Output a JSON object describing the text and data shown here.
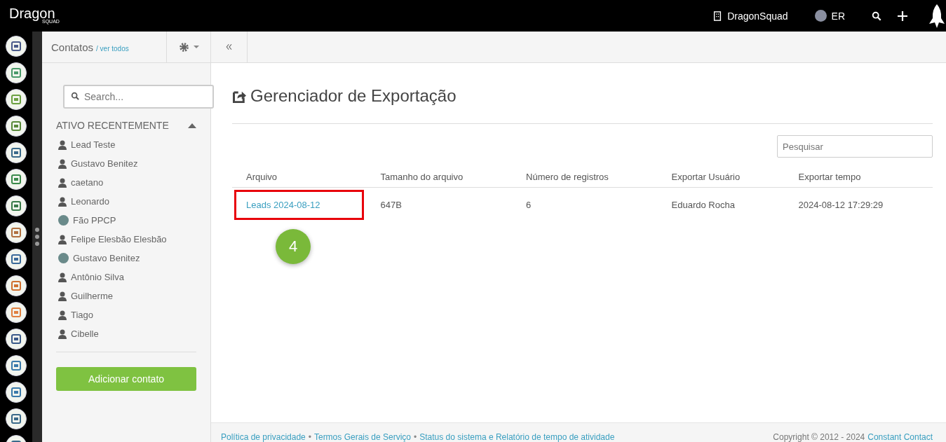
{
  "topbar": {
    "logo": "Dragon",
    "logo_sub": "SQUAD",
    "company": "DragonSquad",
    "user": "ER"
  },
  "sidebar": {
    "title": "Contatos",
    "view_all": "/ ver todos",
    "search": {
      "placeholder": "Search..."
    },
    "section": "ATIVO RECENTEMENTE",
    "section_expanded": true,
    "contacts": [
      {
        "name": "Lead Teste",
        "kind": "person"
      },
      {
        "name": "Gustavo Benitez",
        "kind": "person"
      },
      {
        "name": "caetano",
        "kind": "person"
      },
      {
        "name": "Leonardo",
        "kind": "person"
      },
      {
        "name": "Fão PPCP",
        "kind": "photo"
      },
      {
        "name": "Felipe Elesbão Elesbão",
        "kind": "person"
      },
      {
        "name": "Gustavo Benitez",
        "kind": "photo"
      },
      {
        "name": "Antônio Silva",
        "kind": "person"
      },
      {
        "name": "Guilherme",
        "kind": "person"
      },
      {
        "name": "Tiago",
        "kind": "person"
      },
      {
        "name": "Cibelle",
        "kind": "person"
      }
    ],
    "add_button": "Adicionar contato"
  },
  "main": {
    "title": "Gerenciador de Exportação",
    "search": {
      "placeholder": "Pesquisar"
    },
    "table": {
      "columns": [
        "Arquivo",
        "Tamanho do arquivo",
        "Número de registros",
        "Exportar Usuário",
        "Exportar tempo"
      ],
      "rows": [
        {
          "file": "Leads 2024-08-12",
          "size": "647B",
          "records": "6",
          "user": "Eduardo Rocha",
          "time": "2024-08-12 17:29:29",
          "highlighted": true
        }
      ]
    },
    "step_badge": "4"
  },
  "footer": {
    "links": [
      "Política de privacidade",
      "Termos Gerais de Serviço",
      "Status do sistema e Relatório de tempo de atividade"
    ],
    "separator": "•",
    "copyright": "Copyright © 2012 - 2024",
    "company_link": "Constant Contact"
  }
}
